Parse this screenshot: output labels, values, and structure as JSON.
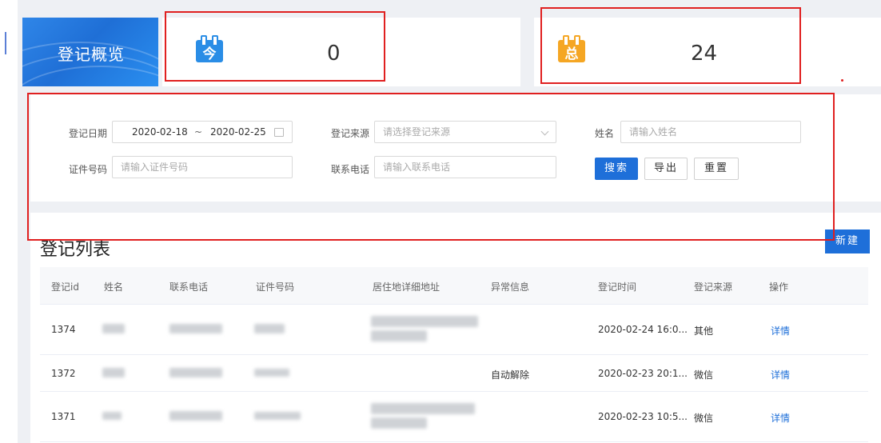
{
  "overview": {
    "title": "登记概览"
  },
  "stats": [
    {
      "icon": "today-calendar-icon",
      "glyph": "今",
      "value": "0",
      "color": "#2a8de6"
    },
    {
      "icon": "total-calendar-icon",
      "glyph": "总",
      "value": "24",
      "color": "#f5a623"
    }
  ],
  "filters": {
    "date_label": "登记日期",
    "date_start": "2020-02-18",
    "date_sep": "~",
    "date_end": "2020-02-25",
    "source_label": "登记来源",
    "source_placeholder": "请选择登记来源",
    "name_label": "姓名",
    "name_placeholder": "请输入姓名",
    "id_label": "证件号码",
    "id_placeholder": "请输入证件号码",
    "phone_label": "联系电话",
    "phone_placeholder": "请输入联系电话",
    "search_btn": "搜索",
    "export_btn": "导出",
    "reset_btn": "重置"
  },
  "list": {
    "title": "登记列表",
    "new_btn": "新建",
    "columns": [
      "登记id",
      "姓名",
      "联系电话",
      "证件号码",
      "居住地详细地址",
      "异常信息",
      "登记时间",
      "登记来源",
      "操作"
    ],
    "rows": [
      {
        "id": "1374",
        "abnormal": "",
        "time": "2020-02-24 16:0...",
        "source": "其他",
        "action": "详情"
      },
      {
        "id": "1372",
        "abnormal": "自动解除",
        "time": "2020-02-23 20:1...",
        "source": "微信",
        "action": "详情"
      },
      {
        "id": "1371",
        "abnormal": "",
        "time": "2020-02-23 10:5...",
        "source": "微信",
        "action": "详情"
      }
    ]
  },
  "accent_color": "#1e6fd9",
  "highlight_color": "#e02020"
}
